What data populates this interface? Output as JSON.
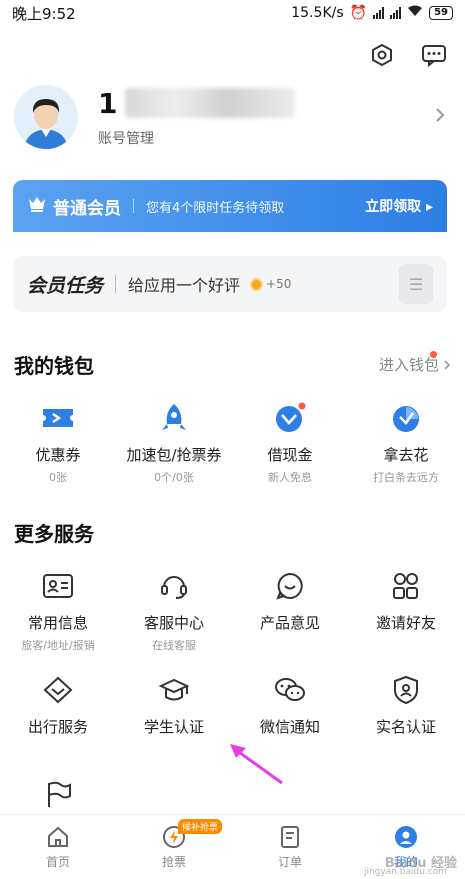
{
  "status": {
    "time": "晚上9:52",
    "speed": "15.5K/s",
    "battery": "59"
  },
  "profile": {
    "name_visible": "1",
    "account_label": "账号管理"
  },
  "vip": {
    "title": "普通会员",
    "desc": "您有4个限时任务待领取",
    "cta": "立即领取 ▸"
  },
  "task": {
    "title": "会员任务",
    "desc": "给应用一个好评",
    "points": "+50"
  },
  "wallet": {
    "title": "我的钱包",
    "link": "进入钱包",
    "items": [
      {
        "label": "优惠券",
        "sub": "0张",
        "icon": "ticket-icon"
      },
      {
        "label": "加速包/抢票券",
        "sub": "0个/0张",
        "icon": "rocket-icon"
      },
      {
        "label": "借现金",
        "sub": "新人免息",
        "icon": "cash-icon"
      },
      {
        "label": "拿去花",
        "sub": "打白条去远方",
        "icon": "credit-icon"
      }
    ]
  },
  "services": {
    "title": "更多服务",
    "row1": [
      {
        "label": "常用信息",
        "sub": "旅客/地址/报销",
        "icon": "id-card-icon"
      },
      {
        "label": "客服中心",
        "sub": "在线客服",
        "icon": "headset-icon"
      },
      {
        "label": "产品意见",
        "sub": "",
        "icon": "feedback-icon"
      },
      {
        "label": "邀请好友",
        "sub": "",
        "icon": "invite-icon"
      }
    ],
    "row2": [
      {
        "label": "出行服务",
        "icon": "travel-icon"
      },
      {
        "label": "学生认证",
        "icon": "graduation-cap-icon"
      },
      {
        "label": "微信通知",
        "icon": "wechat-icon"
      },
      {
        "label": "实名认证",
        "icon": "verify-icon"
      }
    ],
    "row3": [
      {
        "label": "",
        "icon": "flag-icon"
      }
    ]
  },
  "nav": {
    "items": [
      {
        "label": "首页",
        "icon": "home-icon"
      },
      {
        "label": "抢票",
        "icon": "grab-ticket-icon",
        "badge": "候补抢票"
      },
      {
        "label": "订单",
        "icon": "order-icon"
      },
      {
        "label": "我的",
        "icon": "profile-icon"
      }
    ]
  },
  "watermark": {
    "text": "Baidu 经验",
    "sub": "jingyan.baidu.com"
  },
  "colors": {
    "accent": "#2e7fe5",
    "badge": "#ff8a00",
    "annotation": "#e63ee0"
  }
}
